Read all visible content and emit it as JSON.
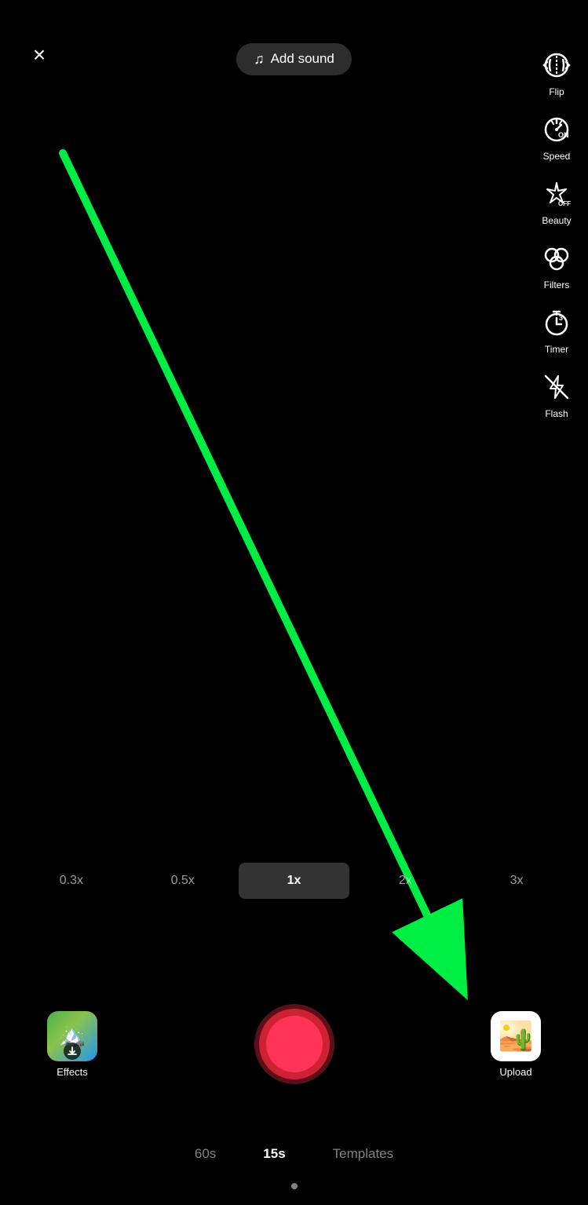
{
  "header": {
    "close_label": "×",
    "add_sound_label": "Add sound"
  },
  "toolbar": {
    "items": [
      {
        "id": "flip",
        "label": "Flip"
      },
      {
        "id": "speed",
        "label": "Speed"
      },
      {
        "id": "beauty",
        "label": "Beauty"
      },
      {
        "id": "filters",
        "label": "Filters"
      },
      {
        "id": "timer",
        "label": "Timer"
      },
      {
        "id": "flash",
        "label": "Flash"
      }
    ]
  },
  "speed_options": [
    {
      "value": "0.3x",
      "active": false
    },
    {
      "value": "0.5x",
      "active": false
    },
    {
      "value": "1x",
      "active": true
    },
    {
      "value": "2x",
      "active": false
    },
    {
      "value": "3x",
      "active": false
    }
  ],
  "bottom": {
    "effects_label": "Effects",
    "upload_label": "Upload"
  },
  "tabs": [
    {
      "label": "60s",
      "active": false
    },
    {
      "label": "15s",
      "active": true
    },
    {
      "label": "Templates",
      "active": false
    }
  ]
}
